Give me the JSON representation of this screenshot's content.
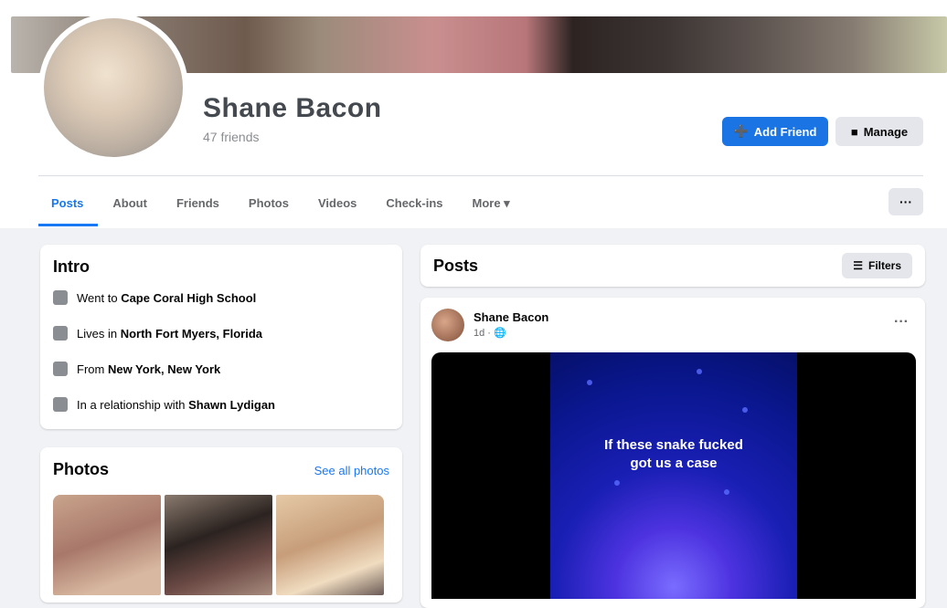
{
  "profile": {
    "name": "Shane Bacon",
    "friend_count": "47 friends",
    "primary_button": "Add Friend",
    "secondary_button": "Manage"
  },
  "tabs": [
    {
      "label": "Posts"
    },
    {
      "label": "About"
    },
    {
      "label": "Friends"
    },
    {
      "label": "Photos"
    },
    {
      "label": "Videos"
    },
    {
      "label": "Check-ins"
    },
    {
      "label": "More ▾"
    }
  ],
  "more_button": "···",
  "intro": {
    "title": "Intro",
    "rows": [
      {
        "prefix": "Went to ",
        "value": "Cape Coral High School",
        "icon": "school-icon"
      },
      {
        "prefix": "Lives in ",
        "value": "North Fort Myers, Florida",
        "icon": "home-icon"
      },
      {
        "prefix": "From ",
        "value": "New York, New York",
        "icon": "location-icon"
      },
      {
        "prefix": "In a relationship with ",
        "value": "Shawn Lydigan",
        "icon": "heart-icon"
      }
    ]
  },
  "photos": {
    "title": "Photos",
    "see_all": "See all photos"
  },
  "posts": {
    "title": "Posts",
    "filters_label": "Filters"
  },
  "post": {
    "author": "Shane Bacon",
    "time": "1d · 🌐",
    "menu": "···",
    "caption": "If these snake fucked\ngot us a case"
  },
  "colors": {
    "accent": "#1877f2",
    "page_bg": "#f0f2f5"
  }
}
